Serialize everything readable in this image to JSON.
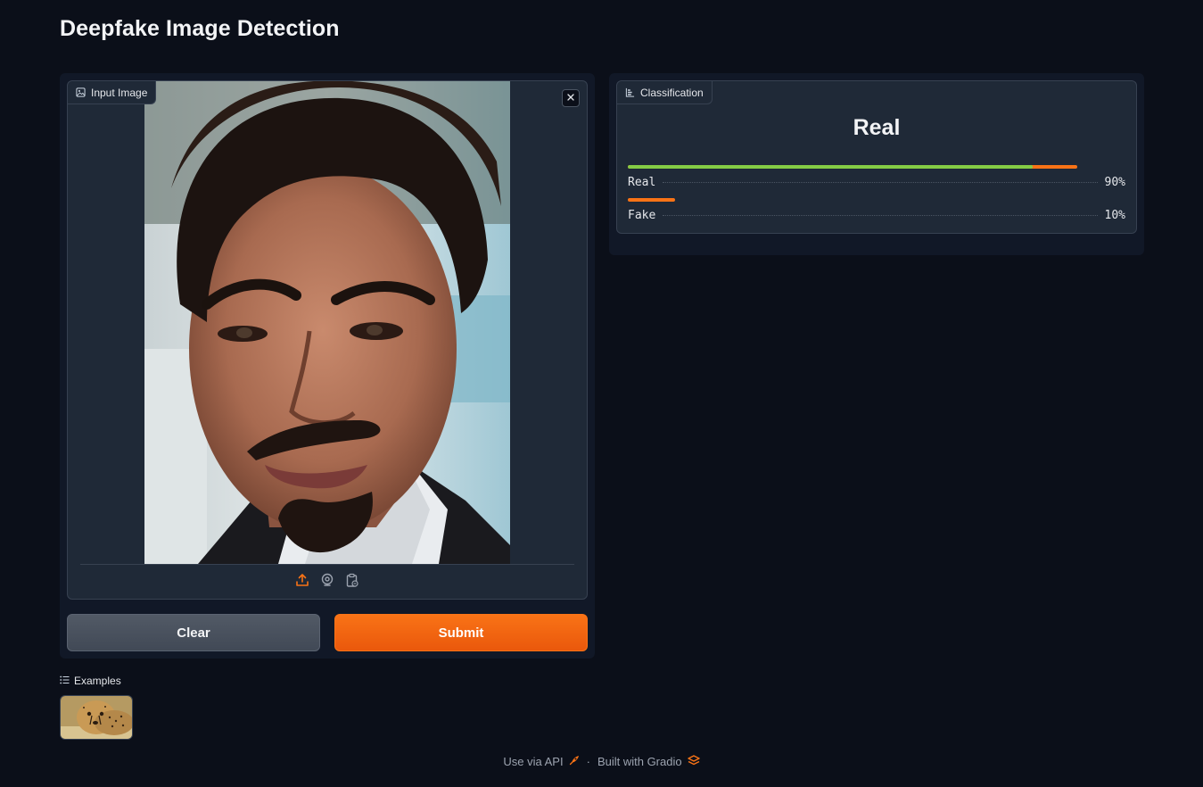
{
  "page": {
    "title": "Deepfake Image Detection"
  },
  "input_image": {
    "label": "Input Image",
    "icon": "image-icon",
    "content": "portrait of a man with dark hair and goatee"
  },
  "source_buttons": [
    {
      "name": "upload-icon",
      "active": true
    },
    {
      "name": "webcam-icon",
      "active": false
    },
    {
      "name": "clipboard-icon",
      "active": false
    }
  ],
  "buttons": {
    "clear": "Clear",
    "submit": "Submit"
  },
  "classification": {
    "label": "Classification",
    "top_label": "Real",
    "confidences": [
      {
        "label": "Real",
        "value": 0.9,
        "text": "90%"
      },
      {
        "label": "Fake",
        "value": 0.1,
        "text": "10%"
      }
    ]
  },
  "examples": {
    "label": "Examples",
    "items": [
      "cheetah"
    ]
  },
  "footer": {
    "api": "Use via API",
    "separator": "·",
    "built": "Built with Gradio"
  },
  "colors": {
    "accent": "#f97316",
    "bar_fill": "#84cc45",
    "background": "#0b0f19",
    "panel": "#1f2937"
  }
}
